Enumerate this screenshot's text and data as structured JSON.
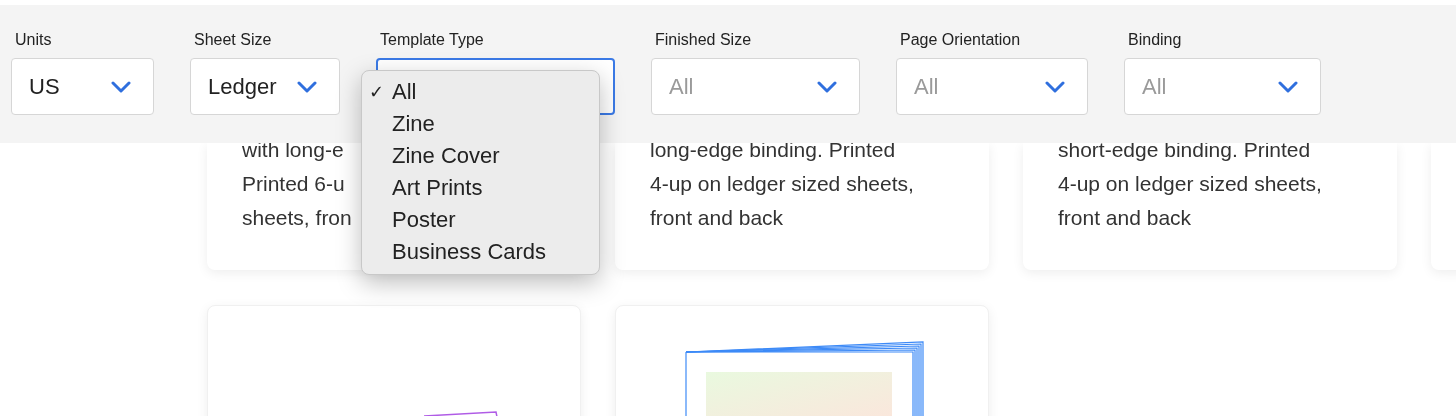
{
  "filters": [
    {
      "label": "Units",
      "value": "US",
      "dimmed": false,
      "open": false
    },
    {
      "label": "Sheet Size",
      "value": "Ledger",
      "dimmed": false,
      "open": false
    },
    {
      "label": "Template Type",
      "open": true,
      "menu": [
        {
          "label": "All",
          "selected": true
        },
        {
          "label": "Zine",
          "selected": false
        },
        {
          "label": "Zine Cover",
          "selected": false
        },
        {
          "label": "Art Prints",
          "selected": false
        },
        {
          "label": "Poster",
          "selected": false
        },
        {
          "label": "Business Cards",
          "selected": false
        }
      ]
    },
    {
      "label": "Finished Size",
      "value": "All",
      "dimmed": true,
      "open": false
    },
    {
      "label": "Page Orientation",
      "value": "All",
      "dimmed": true,
      "open": false
    },
    {
      "label": "Binding",
      "value": "All",
      "dimmed": true,
      "open": false
    }
  ],
  "check_mark": "✓",
  "cards": [
    {
      "kind": "text",
      "lines": [
        "with long-e",
        "Printed 6-u",
        "sheets, fron"
      ]
    },
    {
      "kind": "text",
      "lines": [
        "long-edge binding. Printed",
        "4-up on ledger sized sheets,",
        "front and back"
      ]
    },
    {
      "kind": "text",
      "lines": [
        "short-edge binding. Printed",
        "4-up on ledger sized sheets,",
        "front and back"
      ]
    },
    {
      "kind": "blank"
    }
  ],
  "thumbnails": [
    {
      "kind": "fold-lines"
    },
    {
      "kind": "booklet"
    }
  ]
}
